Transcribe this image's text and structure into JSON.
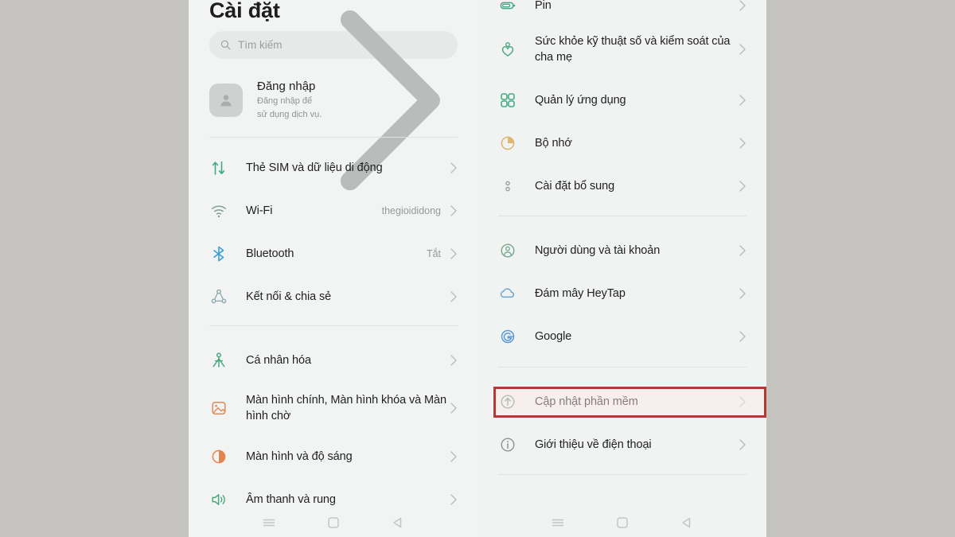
{
  "window": {
    "background_color": "#c5c3c0",
    "screen_background": "#f2f4f3"
  },
  "header": {
    "title": "Cài đặt"
  },
  "search": {
    "placeholder": "Tìm kiếm",
    "value": "",
    "icon": "search-icon"
  },
  "account": {
    "title": "Đăng nhập",
    "subtitle": "Đăng nhập để sử dụng dịch vụ.",
    "avatar_icon": "person-avatar-icon",
    "chevron": "chevron-right-icon"
  },
  "left_column": {
    "group_connectivity": [
      {
        "label": "Thẻ SIM và dữ liệu di động",
        "value": "",
        "icon": "sim-transfer-icon",
        "icon_color": "#3fab82"
      },
      {
        "label": "Wi-Fi",
        "value": "thegioididong",
        "icon": "wifi-icon",
        "icon_color": "#6f9a94"
      },
      {
        "label": "Bluetooth",
        "value": "Tắt",
        "icon": "bluetooth-icon",
        "icon_color": "#3d9fd6"
      },
      {
        "label": "Kết nối & chia sẻ",
        "value": "",
        "icon": "share-nodes-icon",
        "icon_color": "#8fa6ab"
      }
    ],
    "group_display": [
      {
        "label": "Cá nhân hóa",
        "value": "",
        "icon": "personalization-icon",
        "icon_color": "#4aa87f"
      },
      {
        "label": "Màn hình chính, Màn hình khóa và Màn hình chờ",
        "value": "",
        "icon": "home-screen-icon",
        "icon_color": "#e08a5a"
      },
      {
        "label": "Màn hình và độ sáng",
        "value": "",
        "icon": "brightness-icon",
        "icon_color": "#e0864e"
      },
      {
        "label": "Âm thanh và rung",
        "value": "",
        "icon": "sound-vibration-icon",
        "icon_color": "#4aa87f"
      }
    ]
  },
  "right_column": {
    "group_system": [
      {
        "label": "Pin",
        "value": "",
        "icon": "battery-icon",
        "icon_color": "#3fab82"
      },
      {
        "label": "Sức khỏe kỹ thuật số và kiểm soát của cha mẹ",
        "value": "",
        "icon": "digital-wellbeing-icon",
        "icon_color": "#4aa87f"
      },
      {
        "label": "Quản lý ứng dụng",
        "value": "",
        "icon": "apps-grid-icon",
        "icon_color": "#3fab82"
      },
      {
        "label": "Bộ nhớ",
        "value": "",
        "icon": "storage-pie-icon",
        "icon_color": "#dcb46a"
      },
      {
        "label": "Cài đặt bổ sung",
        "value": "",
        "icon": "more-settings-icon",
        "icon_color": "#9aa0a0"
      }
    ],
    "group_accounts": [
      {
        "label": "Người dùng và tài khoản",
        "value": "",
        "icon": "users-accounts-icon",
        "icon_color": "#6fa98c"
      },
      {
        "label": "Đám mây HeyTap",
        "value": "",
        "icon": "cloud-icon",
        "icon_color": "#6ba3cf"
      },
      {
        "label": "Google",
        "value": "",
        "icon": "google-g-icon",
        "icon_color": "#5b9ad5"
      }
    ],
    "group_about": [
      {
        "label": "Cập nhật phần mềm",
        "value": "",
        "icon": "software-update-icon",
        "icon_color": "#6f9e80",
        "highlighted": true
      },
      {
        "label": "Giới thiệu về điện thoại",
        "value": "",
        "icon": "info-icon",
        "icon_color": "#8c9292"
      }
    ]
  },
  "annotation": {
    "highlight_target": "Cập nhật phần mềm",
    "border_color": "#b03a35"
  },
  "navbar": {
    "buttons": [
      {
        "name": "recents-button",
        "icon": "hamburger-menu-icon"
      },
      {
        "name": "home-button",
        "icon": "square-home-icon"
      },
      {
        "name": "back-button",
        "icon": "back-triangle-icon"
      }
    ]
  }
}
